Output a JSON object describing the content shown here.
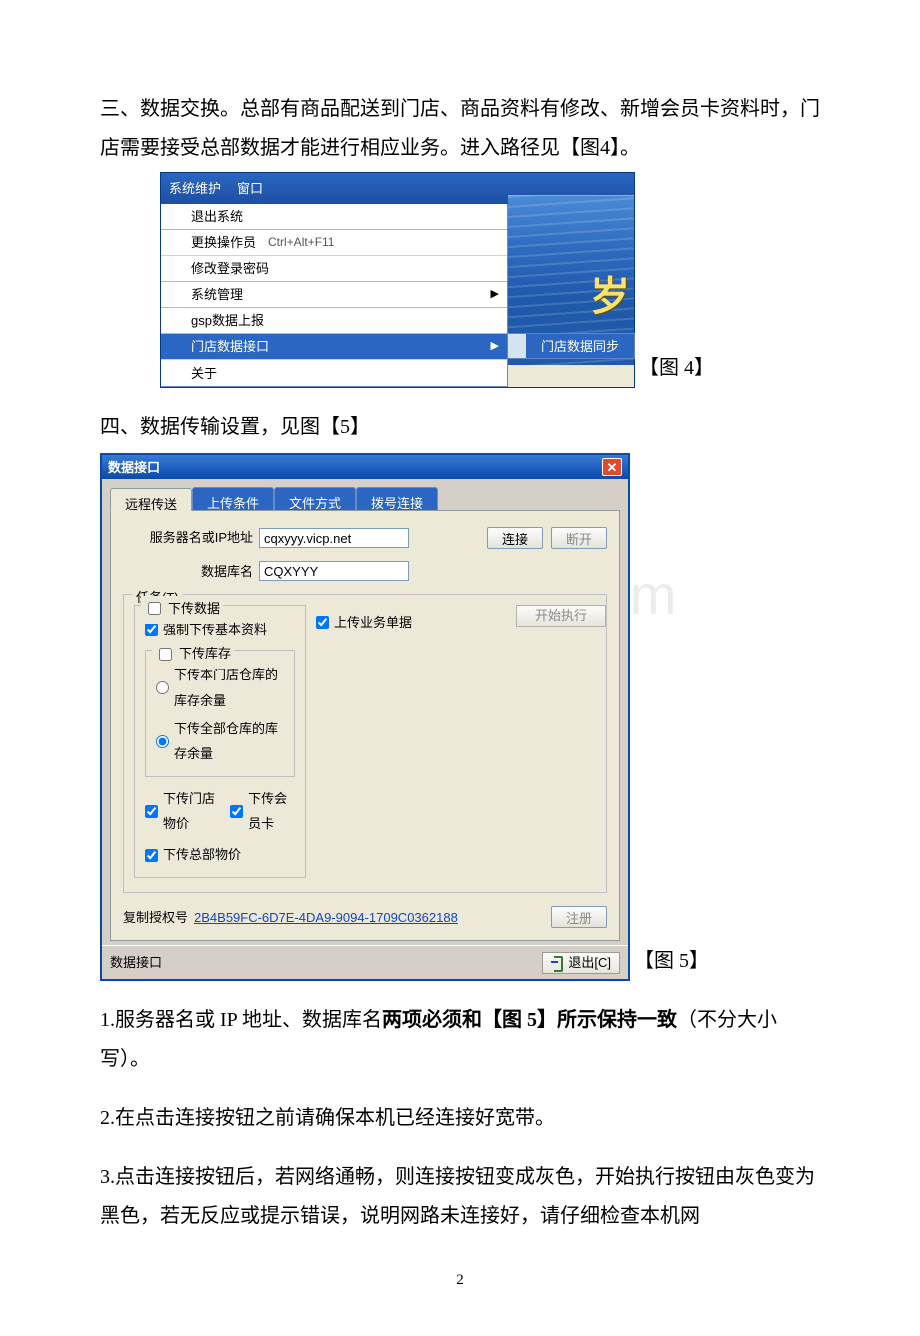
{
  "document": {
    "p1": "三、数据交换。总部有商品配送到门店、商品资料有修改、新增会员卡资料时，门店需要接受总部数据才能进行相应业务。进入路径见【图4】。",
    "p2": "四、数据传输设置，见图【5】",
    "note1a": "1.服务器名或 IP 地址、数据库名",
    "note1b": "两项必须和【图 5】所示保持一致",
    "note1c": "（不分大小写）。",
    "note2": "2.在点击连接按钮之前请确保本机已经连接好宽带。",
    "note3": "3.点击连接按钮后，若网络通畅，则连接按钮变成灰色，开始执行按钮由灰色变为黑色，若无反应或提示错误，说明网路未连接好，请仔细检查本机网",
    "page_num": "2"
  },
  "fig4": {
    "label": "【图 4】",
    "menubar": {
      "m1": "系统维护",
      "m2": "窗口"
    },
    "items": {
      "exit": "退出系统",
      "switch": "更换操作员",
      "switch_key": "Ctrl+Alt+F11",
      "pwd": "修改登录密码",
      "sysmgr": "系统管理",
      "gsp": "gsp数据上报",
      "store_if": "门店数据接口",
      "about": "关于"
    },
    "submenu": "门店数据同步",
    "banner_char": "岁"
  },
  "fig5": {
    "window_title": "数据接口",
    "label": "【图 5】",
    "tabs": {
      "t1": "远程传送",
      "t2": "上传条件",
      "t3": "文件方式",
      "t4": "拨号连接"
    },
    "form": {
      "server_label": "服务器名或IP地址",
      "server_value": "cqxyyy.vicp.net",
      "db_label": "数据库名",
      "db_value": "CQXYYY",
      "connect": "连接",
      "disconnect": "断开"
    },
    "tasks": {
      "legend": "任务(T)",
      "download_legend": "下传数据",
      "force_dl": "强制下传基本资料",
      "stock_legend": "下传库存",
      "stock_opt1": "下传本门店仓库的库存余量",
      "stock_opt2": "下传全部仓库的库存余量",
      "price_store": "下传门店物价",
      "member_card": "下传会员卡",
      "price_hq": "下传总部物价",
      "upload_biz": "上传业务单据",
      "start": "开始执行"
    },
    "auth": {
      "label": "复制授权号",
      "value": "2B4B59FC-6D7E-4DA9-9094-1709C0362188",
      "register": "注册"
    },
    "status": "数据接口",
    "exit": "退出[C]"
  },
  "watermark": "www.bdocx.com"
}
